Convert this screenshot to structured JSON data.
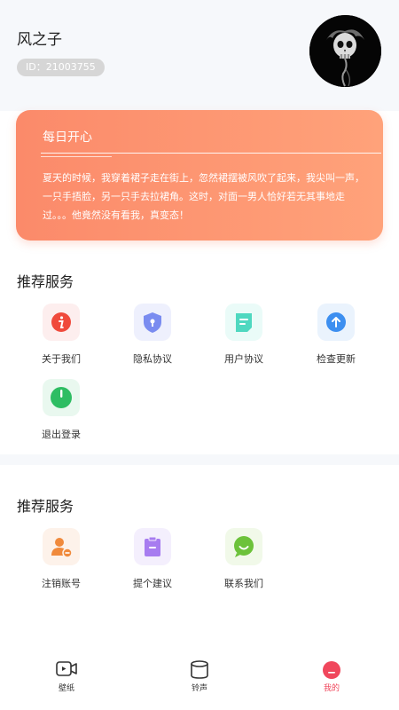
{
  "profile": {
    "username": "风之子",
    "user_id": "ID：21003755"
  },
  "joke_card": {
    "title": "每日开心",
    "text": "夏天的时候，我穿着裙子走在街上，忽然裙摆被风吹了起来，我尖叫一声，一只手捂脸，另一只手去拉裙角。这时，对面一男人恰好若无其事地走过。。。他竟然没有看我，真变态！"
  },
  "services": {
    "title": "推荐服务",
    "items": [
      {
        "label": "关于我们",
        "icon": "info-icon",
        "color": "#f04a3c",
        "bg": "#fdeeee"
      },
      {
        "label": "隐私协议",
        "icon": "shield-lock-icon",
        "color": "#7a8cf0",
        "bg": "#eef0fd"
      },
      {
        "label": "用户协议",
        "icon": "document-icon",
        "color": "#4fd8c0",
        "bg": "#eafbf8"
      },
      {
        "label": "检查更新",
        "icon": "upload-arrow-icon",
        "color": "#3d8ff0",
        "bg": "#eaf3fd"
      },
      {
        "label": "退出登录",
        "icon": "power-icon",
        "color": "#2ebd63",
        "bg": "#e9f8ef"
      }
    ]
  },
  "services2": {
    "title": "推荐服务",
    "items": [
      {
        "label": "注销账号",
        "icon": "user-remove-icon",
        "color": "#f08a3c",
        "bg": "#fdf2ea"
      },
      {
        "label": "提个建议",
        "icon": "clipboard-icon",
        "color": "#a77cf0",
        "bg": "#f4effd"
      },
      {
        "label": "联系我们",
        "icon": "chat-smile-icon",
        "color": "#6cc23a",
        "bg": "#f1f9e9"
      }
    ]
  },
  "tabbar": {
    "items": [
      {
        "label": "壁纸",
        "icon": "video-icon"
      },
      {
        "label": "铃声",
        "icon": "cylinder-icon"
      },
      {
        "label": "我的",
        "icon": "profile-icon",
        "active": true
      }
    ]
  },
  "colors": {
    "accent": "#f0475c",
    "card_start": "#fb8a6a",
    "card_end": "#ffa27a"
  }
}
